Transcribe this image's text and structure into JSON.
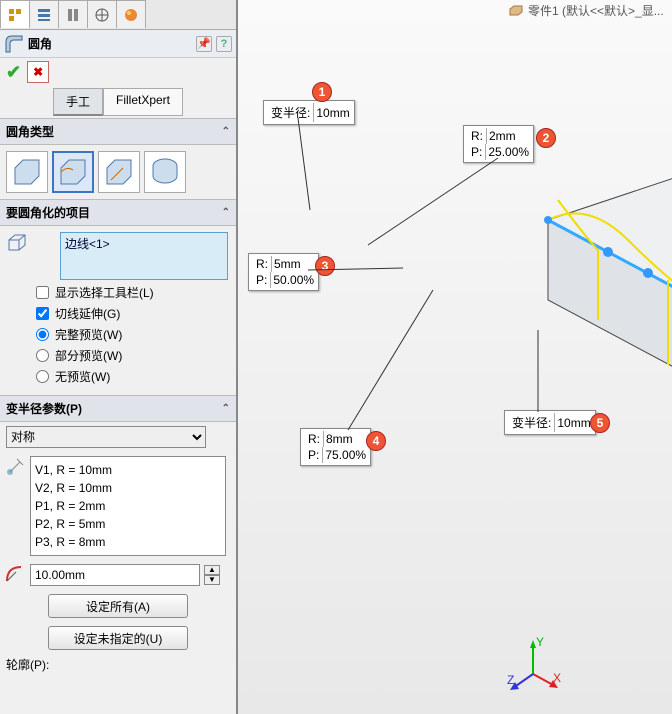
{
  "breadcrumb": "零件1 (默认<<默认>_显...",
  "title": "圆角",
  "mode_tabs": {
    "manual": "手工",
    "xpert": "FilletXpert"
  },
  "sections": {
    "type": "圆角类型",
    "items": "要圆角化的项目",
    "params": "变半径参数(P)",
    "profile": "轮廓(P):"
  },
  "selection": "边线<1>",
  "options": {
    "show_toolbar": "显示选择工具栏(L)",
    "tangent": "切线延伸(G)",
    "full_preview": "完整预览(W)",
    "partial_preview": "部分预览(W)",
    "no_preview": "无预览(W)"
  },
  "symmetry": "对称",
  "param_list": [
    "V1, R = 10mm",
    "V2, R = 10mm",
    "P1, R = 2mm",
    "P2, R = 5mm",
    "P3, R = 8mm"
  ],
  "radius_value": "10.00mm",
  "buttons": {
    "set_all": "设定所有(A)",
    "set_unspec": "设定未指定的(U)"
  },
  "callouts": {
    "c1": {
      "label": "变半径:",
      "value": "10mm"
    },
    "c2": {
      "r_label": "R:",
      "r_value": "2mm",
      "p_label": "P:",
      "p_value": "25.00%"
    },
    "c3": {
      "r_label": "R:",
      "r_value": "5mm",
      "p_label": "P:",
      "p_value": "50.00%"
    },
    "c4": {
      "r_label": "R:",
      "r_value": "8mm",
      "p_label": "P:",
      "p_value": "75.00%"
    },
    "c5": {
      "label": "变半径:",
      "value": "10mm"
    }
  },
  "badges": {
    "b1": "1",
    "b2": "2",
    "b3": "3",
    "b4": "4",
    "b5": "5"
  },
  "triad": {
    "x": "X",
    "y": "Y",
    "z": "Z"
  }
}
